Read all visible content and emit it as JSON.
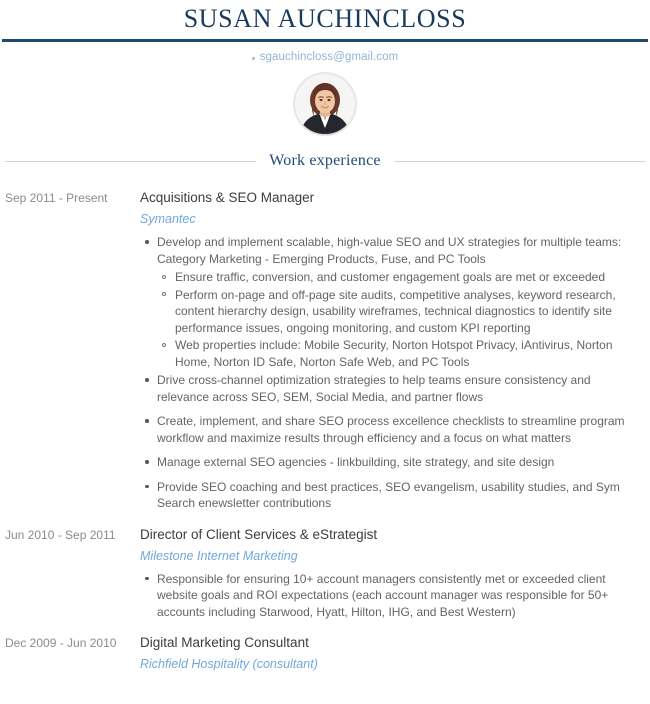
{
  "header": {
    "name": "SUSAN AUCHINCLOSS",
    "rule_color": "#1e4a72",
    "name_color": "#1a3a5c"
  },
  "contact": {
    "marker_icon": "square-bullet-icon",
    "email": "sgauchincloss@gmail.com",
    "email_color": "#8fb3d9"
  },
  "photo": {
    "icon": "profile-photo-avatar",
    "alt": "Profile photo of Susan Auchincloss"
  },
  "section": {
    "title": "Work experience",
    "title_color": "#1f4a78",
    "line_color": "#c9d6e4"
  },
  "jobs": [
    {
      "dates": "Sep 2011 - Present",
      "title": "Acquisitions & SEO Manager",
      "company": "Symantec",
      "bullets": [
        {
          "text": "Develop and implement scalable, high-value SEO and UX strategies for multiple teams: Category Marketing - Emerging Products, Fuse, and PC Tools",
          "subbullets": [
            "Ensure traffic, conversion, and customer engagement goals are met or exceeded",
            "Perform on-page and off-page site audits, competitive analyses, keyword research, content hierarchy design, usability wireframes, technical diagnostics to identify site performance issues, ongoing monitoring, and custom KPI reporting",
            "Web properties include: Mobile Security, Norton Hotspot Privacy, iAntivirus, Norton Home, Norton ID Safe, Norton Safe Web, and PC Tools"
          ]
        },
        {
          "text": "Drive cross-channel optimization strategies to help teams ensure consistency and relevance across SEO, SEM, Social Media, and partner flows",
          "subbullets": []
        },
        {
          "text": "Create, implement, and share SEO process excellence checklists to streamline program workflow and maximize results through efficiency and a focus on what matters",
          "subbullets": []
        },
        {
          "text": "Manage external SEO agencies - linkbuilding, site strategy, and site design",
          "subbullets": []
        },
        {
          "text": "Provide SEO coaching and best practices, SEO evangelism, usability studies, and Sym Search enewsletter contributions",
          "subbullets": []
        }
      ]
    },
    {
      "dates": "Jun 2010 - Sep 2011",
      "title": "Director of Client Services & eStrategist",
      "company": "Milestone Internet Marketing",
      "bullets": [
        {
          "text": "Responsible for ensuring 10+ account managers consistently met or exceeded client website goals and ROI expectations (each account manager was responsible for 50+ accounts including Starwood, Hyatt, Hilton, IHG, and Best Western)",
          "subbullets": []
        }
      ]
    },
    {
      "dates": "Dec 2009 - Jun 2010",
      "title": "Digital Marketing Consultant",
      "company": "Richfield Hospitality (consultant)",
      "bullets": []
    }
  ]
}
